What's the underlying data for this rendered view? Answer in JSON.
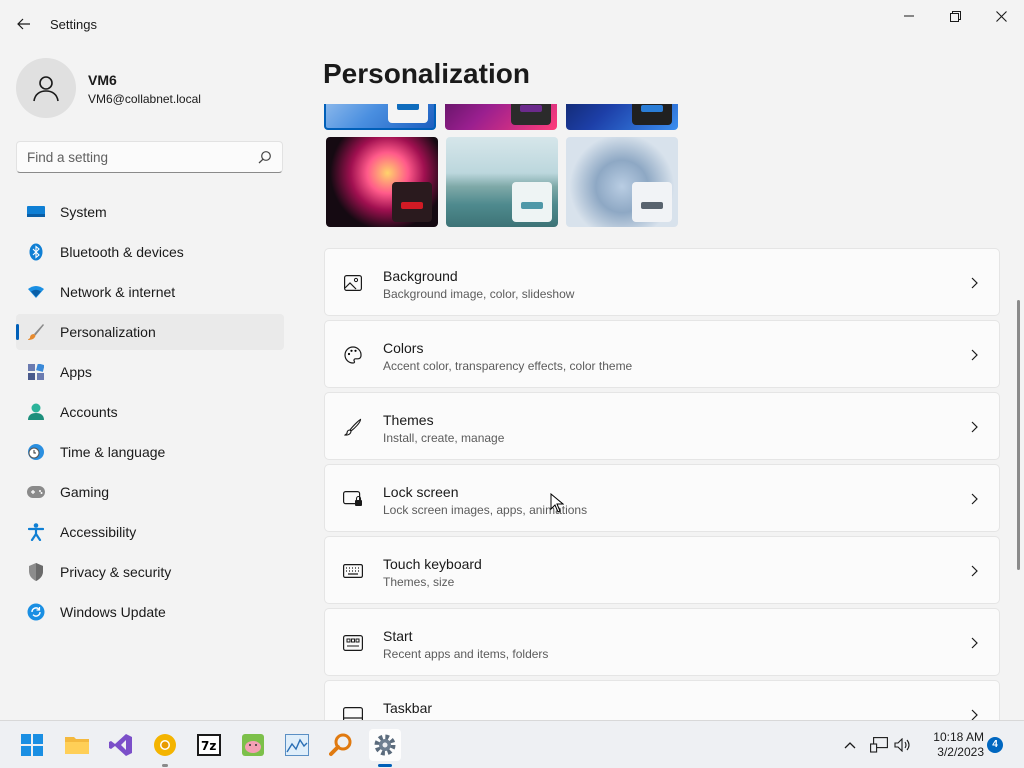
{
  "window": {
    "title": "Settings"
  },
  "profile": {
    "name": "VM6",
    "email": "VM6@collabnet.local"
  },
  "search": {
    "placeholder": "Find a setting"
  },
  "nav": {
    "items": [
      {
        "label": "System",
        "icon": "system-icon"
      },
      {
        "label": "Bluetooth & devices",
        "icon": "bluetooth-icon"
      },
      {
        "label": "Network & internet",
        "icon": "wifi-icon"
      },
      {
        "label": "Personalization",
        "icon": "brush-icon",
        "active": true
      },
      {
        "label": "Apps",
        "icon": "apps-icon"
      },
      {
        "label": "Accounts",
        "icon": "accounts-icon"
      },
      {
        "label": "Time & language",
        "icon": "clock-globe-icon"
      },
      {
        "label": "Gaming",
        "icon": "gamepad-icon"
      },
      {
        "label": "Accessibility",
        "icon": "accessibility-icon"
      },
      {
        "label": "Privacy & security",
        "icon": "shield-icon"
      },
      {
        "label": "Windows Update",
        "icon": "update-icon"
      }
    ]
  },
  "main": {
    "title": "Personalization",
    "cards": [
      {
        "title": "Background",
        "subtitle": "Background image, color, slideshow",
        "icon": "image-icon"
      },
      {
        "title": "Colors",
        "subtitle": "Accent color, transparency effects, color theme",
        "icon": "palette-icon"
      },
      {
        "title": "Themes",
        "subtitle": "Install, create, manage",
        "icon": "pen-icon"
      },
      {
        "title": "Lock screen",
        "subtitle": "Lock screen images, apps, animations",
        "icon": "lock-screen-icon"
      },
      {
        "title": "Touch keyboard",
        "subtitle": "Themes, size",
        "icon": "keyboard-icon"
      },
      {
        "title": "Start",
        "subtitle": "Recent apps and items, folders",
        "icon": "start-icon"
      },
      {
        "title": "Taskbar",
        "subtitle": "",
        "icon": "taskbar-icon"
      }
    ]
  },
  "taskbar": {
    "time": "10:18 AM",
    "date": "3/2/2023",
    "notifications": "4"
  },
  "colors": {
    "accent": "#005fb8",
    "background": "#f3f3f3",
    "card": "#fbfbfb"
  }
}
